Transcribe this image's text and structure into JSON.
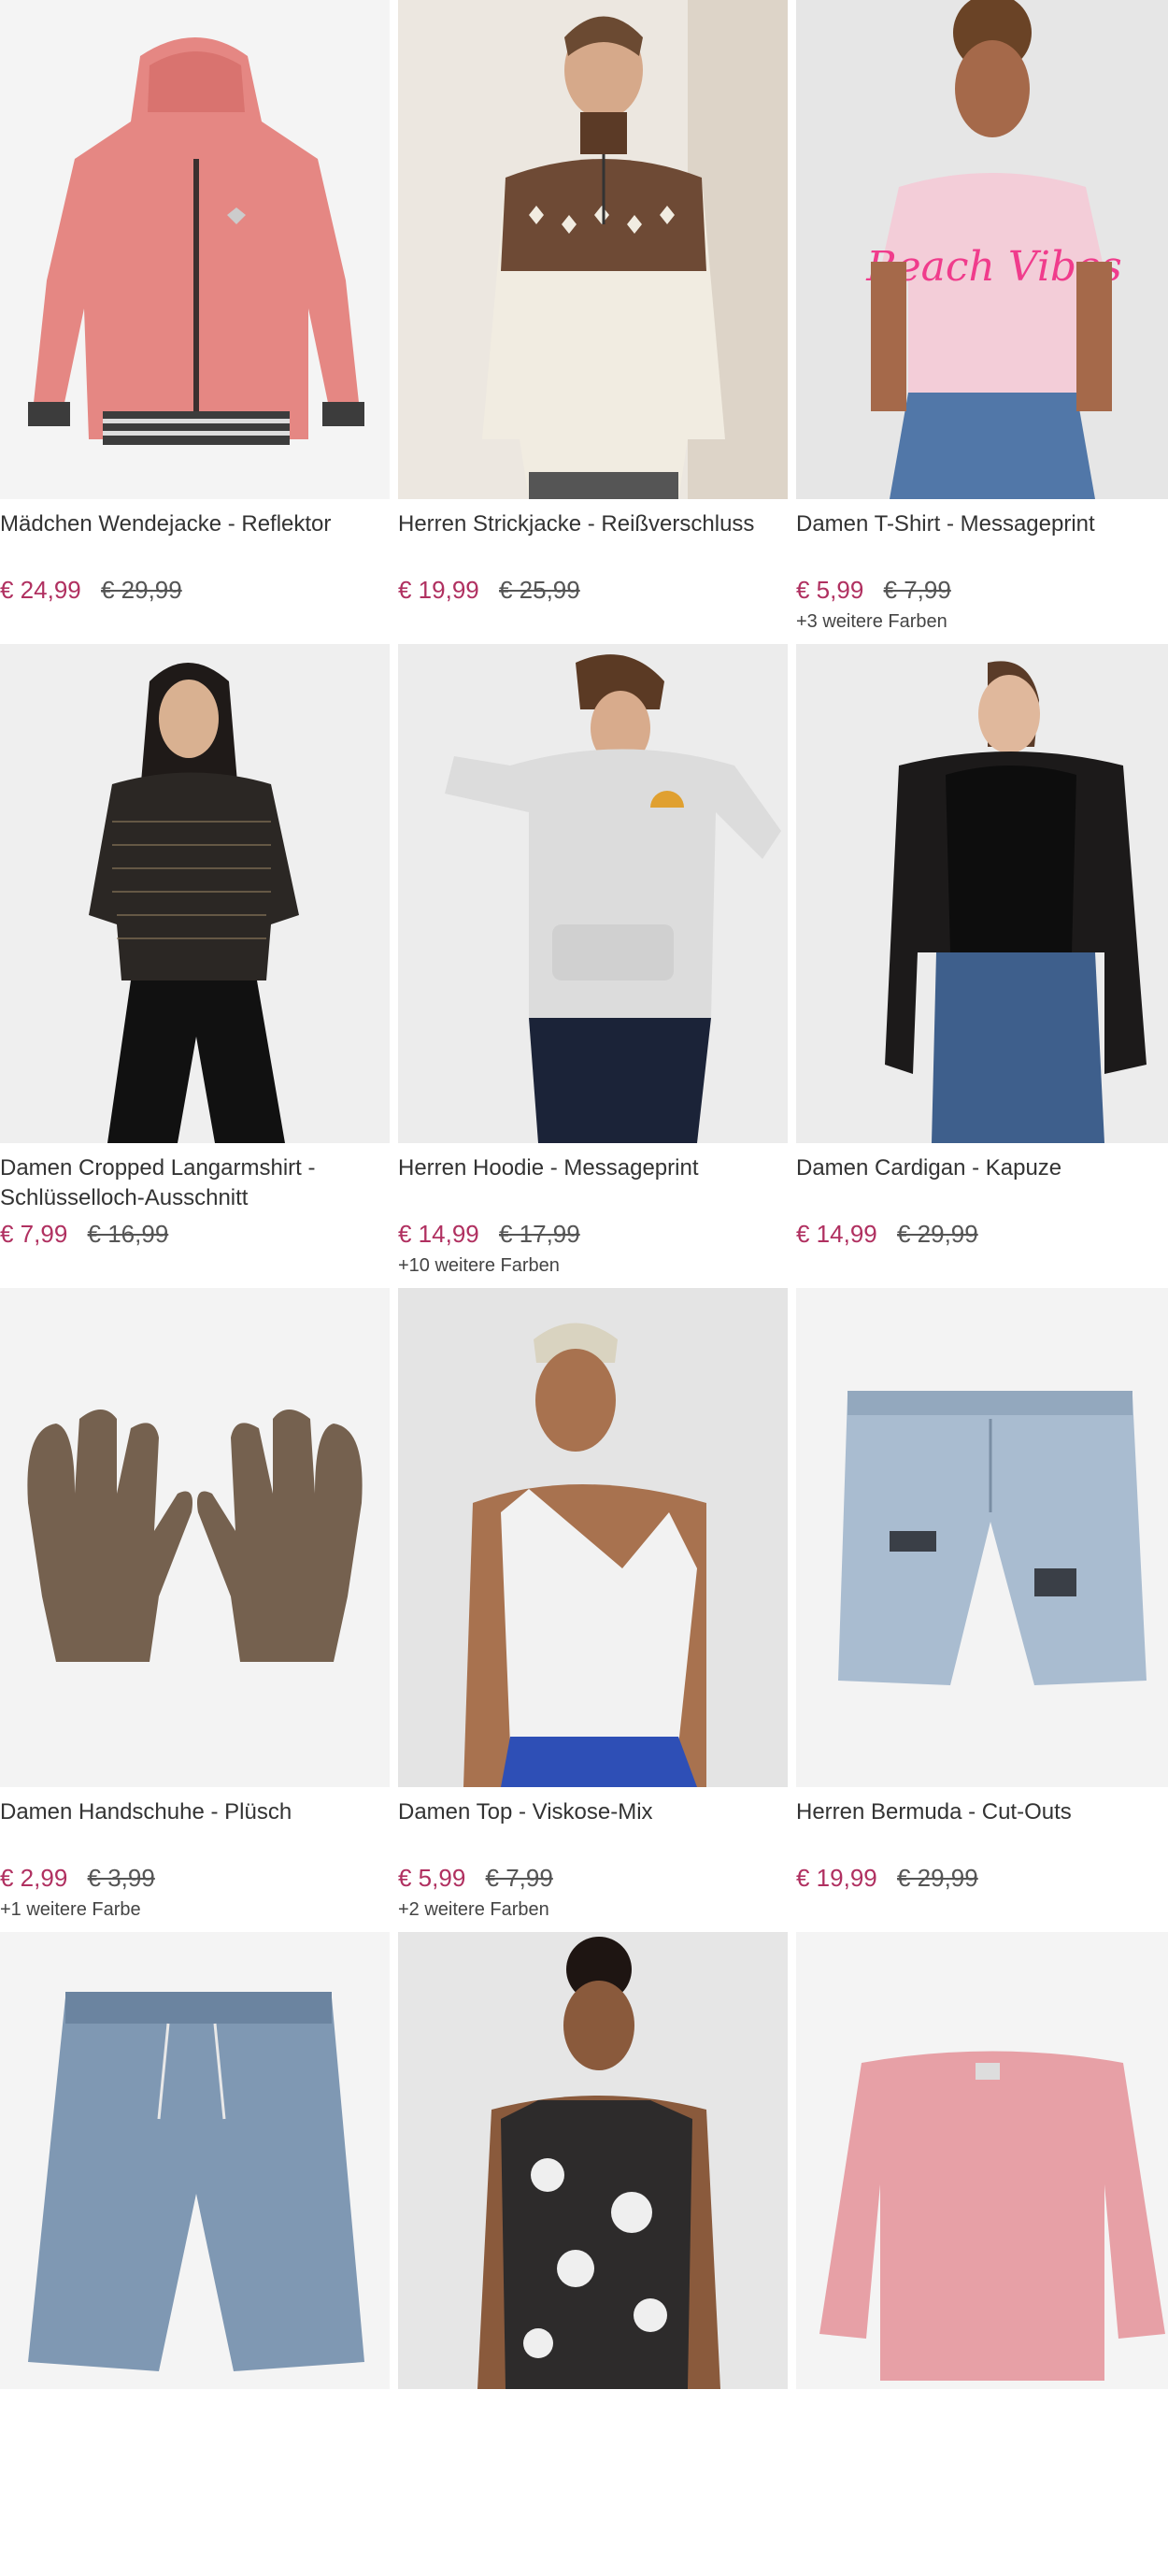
{
  "colors": {
    "price_accent": "#b03060",
    "old_price": "#555555",
    "name_text": "#333333",
    "photo_bg_light": "#f2f2f2",
    "photo_bg_studio": "#e9e9e9"
  },
  "products": [
    {
      "name": "Mädchen Wendejacke - Reflektor",
      "price": "€ 24,99",
      "old_price": "€ 29,99",
      "more_colors": "",
      "image": "pink-quilted-jacket"
    },
    {
      "name": "Herren Strickjacke - Reißverschluss",
      "price": "€ 19,99",
      "old_price": "€ 25,99",
      "more_colors": "",
      "image": "man-norwegian-knit-sweater"
    },
    {
      "name": "Damen T-Shirt - Messageprint",
      "price": "€ 5,99",
      "old_price": "€ 7,99",
      "more_colors": "+3 weitere Farben",
      "image": "woman-pink-tshirt",
      "print_text": "Beach Vibes"
    },
    {
      "name": "Damen Cropped Langarmshirt - Schlüsselloch-Ausschnitt",
      "price": "€ 7,99",
      "old_price": "€ 16,99",
      "more_colors": "",
      "image": "woman-black-glitter-top"
    },
    {
      "name": "Herren Hoodie - Messageprint",
      "price": "€ 14,99",
      "old_price": "€ 17,99",
      "more_colors": "+10 weitere Farben",
      "image": "man-grey-hoodie"
    },
    {
      "name": "Damen Cardigan - Kapuze",
      "price": "€ 14,99",
      "old_price": "€ 29,99",
      "more_colors": "",
      "image": "woman-black-cardigan"
    },
    {
      "name": "Damen Handschuhe - Plüsch",
      "price": "€ 2,99",
      "old_price": "€ 3,99",
      "more_colors": "+1 weitere Farbe",
      "image": "brown-plush-gloves"
    },
    {
      "name": "Damen Top - Viskose-Mix",
      "price": "€ 5,99",
      "old_price": "€ 7,99",
      "more_colors": "+2 weitere Farben",
      "image": "woman-white-one-shoulder-top"
    },
    {
      "name": "Herren Bermuda - Cut-Outs",
      "price": "€ 19,99",
      "old_price": "€ 29,99",
      "more_colors": "",
      "image": "light-denim-bermuda"
    },
    {
      "name": "",
      "price": "",
      "old_price": "",
      "more_colors": "",
      "image": "denim-jogger-shorts"
    },
    {
      "name": "",
      "price": "",
      "old_price": "",
      "more_colors": "",
      "image": "woman-floral-top"
    },
    {
      "name": "",
      "price": "",
      "old_price": "",
      "more_colors": "",
      "image": "pink-sweater"
    }
  ]
}
